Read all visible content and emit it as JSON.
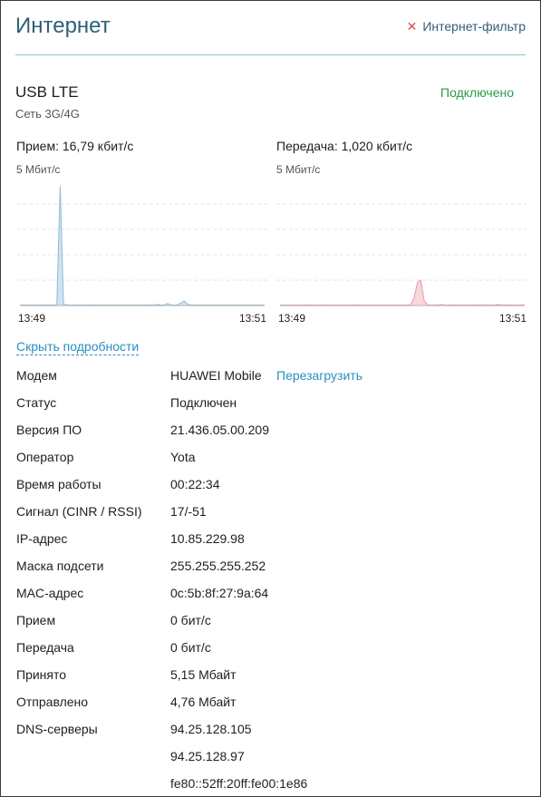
{
  "header": {
    "title": "Интернет",
    "filter_label": "Интернет-фильтр"
  },
  "connection": {
    "name": "USB LTE",
    "network": "Сеть 3G/4G",
    "status": "Подключено"
  },
  "charts": {
    "rx": {
      "title": "Прием: 16,79 кбит/с",
      "scale_label": "5 Мбит/с",
      "time_start": "13:49",
      "time_end": "13:51",
      "fill": "#cfe3f1",
      "stroke": "#8fbad8",
      "max_mbps": 5,
      "samples_mbps": [
        0.02,
        0.02,
        0.02,
        0.02,
        0.02,
        0.02,
        0.02,
        0.02,
        0.03,
        0.03,
        0.02,
        0.02,
        4.7,
        0.05,
        0.03,
        0.02,
        0.02,
        0.02,
        0.02,
        0.02,
        0.02,
        0.02,
        0.03,
        0.02,
        0.02,
        0.02,
        0.02,
        0.02,
        0.02,
        0.02,
        0.02,
        0.02,
        0.02,
        0.02,
        0.02,
        0.02,
        0.02,
        0.02,
        0.03,
        0.02,
        0.02,
        0.04,
        0.03,
        0.02,
        0.08,
        0.03,
        0.02,
        0.02,
        0.1,
        0.18,
        0.05,
        0.02,
        0.02,
        0.02,
        0.02,
        0.02,
        0.02,
        0.02,
        0.02,
        0.02,
        0.02,
        0.02,
        0.02,
        0.02,
        0.02,
        0.02,
        0.02,
        0.02,
        0.02,
        0.02,
        0.02,
        0.02,
        0.02,
        0.02
      ]
    },
    "tx": {
      "title": "Передача: 1,020 кбит/с",
      "scale_label": "5 Мбит/с",
      "time_start": "13:49",
      "time_end": "13:51",
      "fill": "#f7d7dc",
      "stroke": "#e69aa6",
      "max_mbps": 5,
      "samples_mbps": [
        0.02,
        0.02,
        0.02,
        0.02,
        0.02,
        0.02,
        0.02,
        0.02,
        0.03,
        0.02,
        0.02,
        0.02,
        0.02,
        0.02,
        0.03,
        0.02,
        0.02,
        0.02,
        0.02,
        0.02,
        0.02,
        0.02,
        0.02,
        0.03,
        0.02,
        0.02,
        0.02,
        0.02,
        0.02,
        0.02,
        0.02,
        0.02,
        0.02,
        0.02,
        0.02,
        0.02,
        0.02,
        0.02,
        0.02,
        0.02,
        0.3,
        0.9,
        1.0,
        0.2,
        0.03,
        0.02,
        0.02,
        0.02,
        0.04,
        0.03,
        0.02,
        0.02,
        0.03,
        0.02,
        0.02,
        0.03,
        0.02,
        0.02,
        0.03,
        0.02,
        0.02,
        0.03,
        0.02,
        0.02,
        0.02,
        0.04,
        0.02,
        0.02,
        0.03,
        0.02,
        0.02,
        0.02,
        0.03,
        0.02
      ]
    }
  },
  "details": {
    "toggle_label": "Скрыть подробности",
    "rows": [
      {
        "label": "Модем",
        "value": "HUAWEI Mobile",
        "action": "Перезагрузить"
      },
      {
        "label": "Статус",
        "value": "Подключен"
      },
      {
        "label": "Версия ПО",
        "value": "21.436.05.00.209"
      },
      {
        "label": "Оператор",
        "value": "Yota"
      },
      {
        "label": "Время работы",
        "value": "00:22:34"
      },
      {
        "label": "Сигнал (CINR / RSSI)",
        "value": "17/-51"
      },
      {
        "label": "IP-адрес",
        "value": "10.85.229.98"
      },
      {
        "label": "Маска подсети",
        "value": "255.255.255.252"
      },
      {
        "label": "MAC-адрес",
        "value": "0c:5b:8f:27:9a:64"
      },
      {
        "label": "Прием",
        "value": "0 бит/с"
      },
      {
        "label": "Передача",
        "value": "0 бит/с"
      },
      {
        "label": "Принято",
        "value": "5,15 Мбайт"
      },
      {
        "label": "Отправлено",
        "value": "4,76 Мбайт"
      },
      {
        "label": "DNS-серверы",
        "value": "94.25.128.105"
      },
      {
        "label": "",
        "value": "94.25.128.97"
      },
      {
        "label": "",
        "value": "fe80::52ff:20ff:fe00:1e86"
      }
    ]
  }
}
